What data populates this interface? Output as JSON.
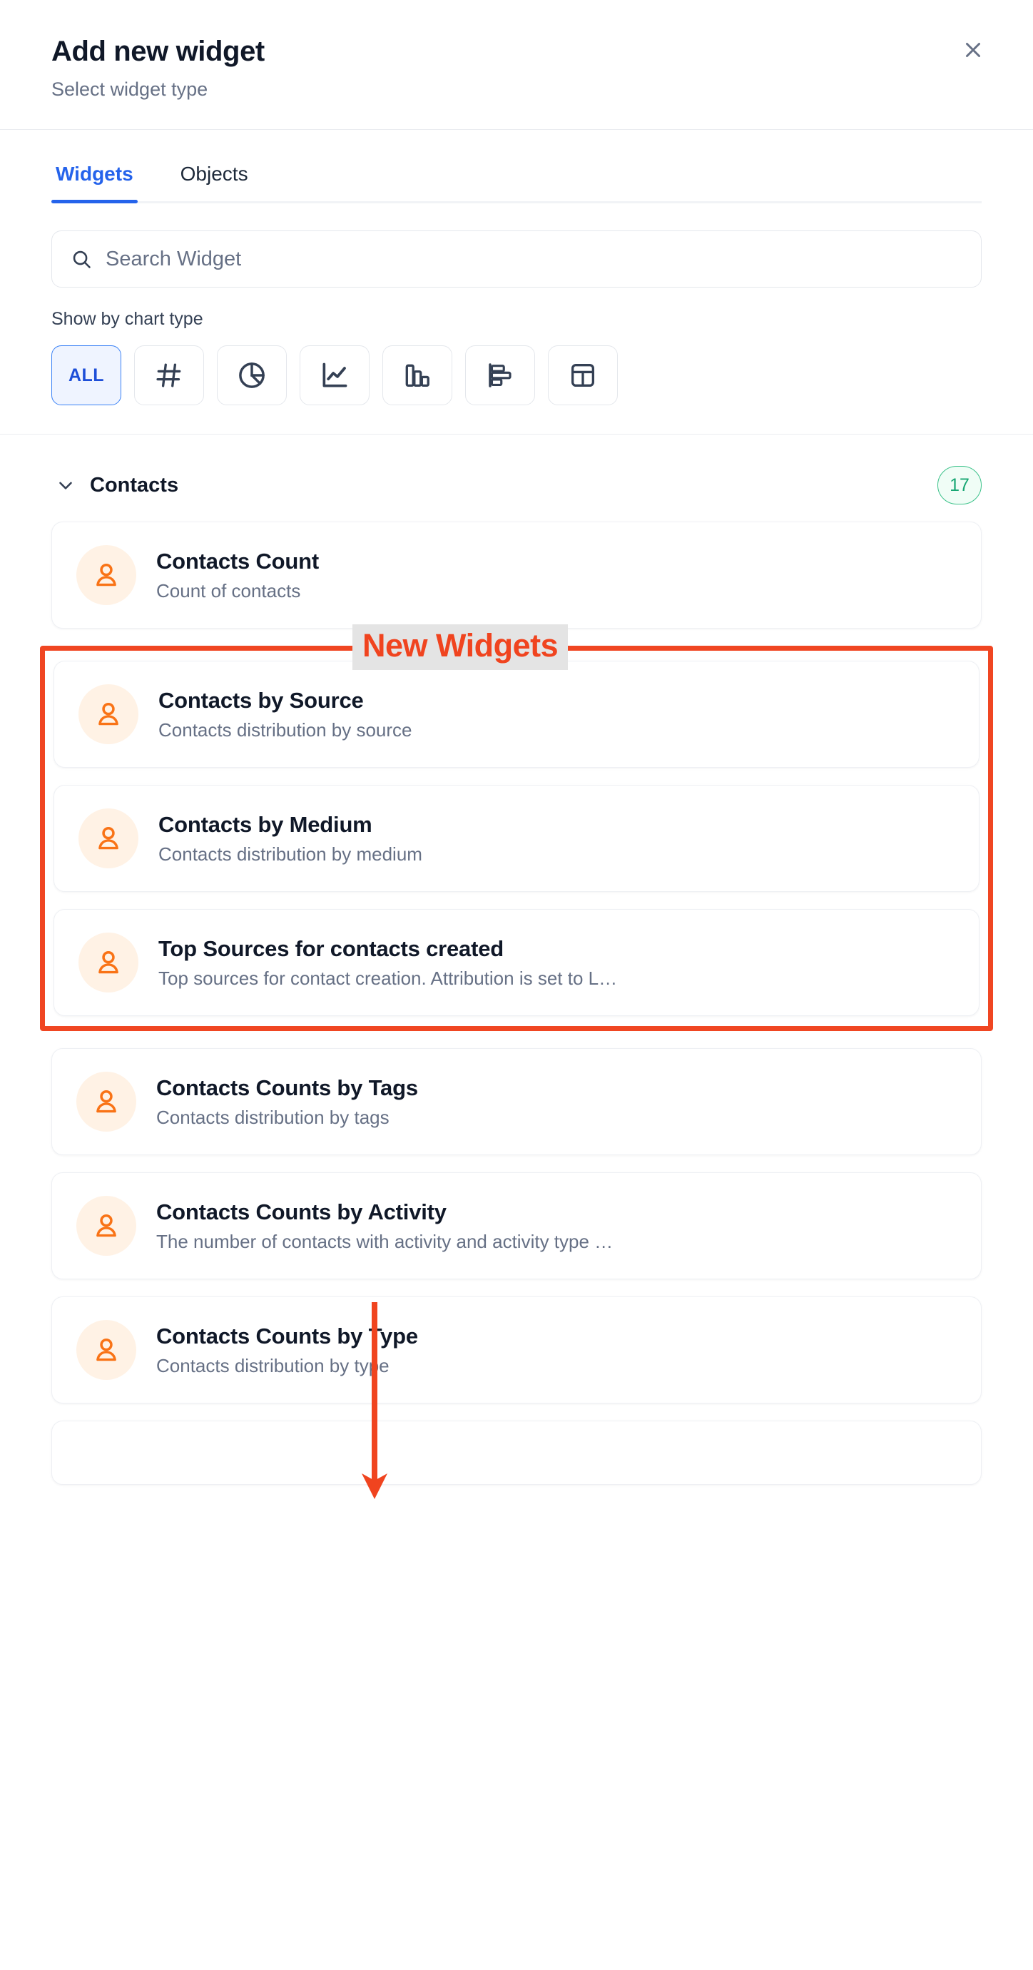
{
  "header": {
    "title": "Add new widget",
    "subtitle": "Select widget type",
    "close_label": "Close"
  },
  "tabs": [
    {
      "label": "Widgets",
      "active": true
    },
    {
      "label": "Objects",
      "active": false
    }
  ],
  "search": {
    "placeholder": "Search Widget",
    "value": ""
  },
  "filters": {
    "label": "Show by chart type",
    "items": [
      {
        "label": "ALL",
        "icon": "all-text",
        "active": true
      },
      {
        "label": "",
        "icon": "hash-number-icon",
        "active": false
      },
      {
        "label": "",
        "icon": "pie-chart-icon",
        "active": false
      },
      {
        "label": "",
        "icon": "line-chart-icon",
        "active": false
      },
      {
        "label": "",
        "icon": "column-chart-icon",
        "active": false
      },
      {
        "label": "",
        "icon": "horizontal-bar-chart-icon",
        "active": false
      },
      {
        "label": "",
        "icon": "table-icon",
        "active": false
      }
    ]
  },
  "group": {
    "title": "Contacts",
    "count": "17",
    "chevron": "chevron-down-icon"
  },
  "annotation": {
    "text": "New Widgets",
    "color": "#f0441f",
    "highlight_background": "#e4e4e4",
    "box_color": "#f04622"
  },
  "widgets_before": [
    {
      "title": "Contacts Count",
      "description": "Count of contacts",
      "icon": "contact-person-icon"
    }
  ],
  "widgets_highlighted": [
    {
      "title": "Contacts by Source",
      "description": "Contacts distribution by source",
      "icon": "contact-person-icon"
    },
    {
      "title": "Contacts by Medium",
      "description": "Contacts distribution by medium",
      "icon": "contact-person-icon"
    },
    {
      "title": "Top Sources for contacts created",
      "description": "Top sources for contact creation. Attribution is set to L…",
      "icon": "contact-person-icon"
    }
  ],
  "widgets_after": [
    {
      "title": "Contacts Counts by Tags",
      "description": "Contacts distribution by tags",
      "icon": "contact-person-icon"
    },
    {
      "title": "Contacts Counts by Activity",
      "description": "The number of contacts with activity and activity type …",
      "icon": "contact-person-icon"
    },
    {
      "title": "Contacts Counts by Type",
      "description": "Contacts distribution by type",
      "icon": "contact-person-icon"
    }
  ]
}
